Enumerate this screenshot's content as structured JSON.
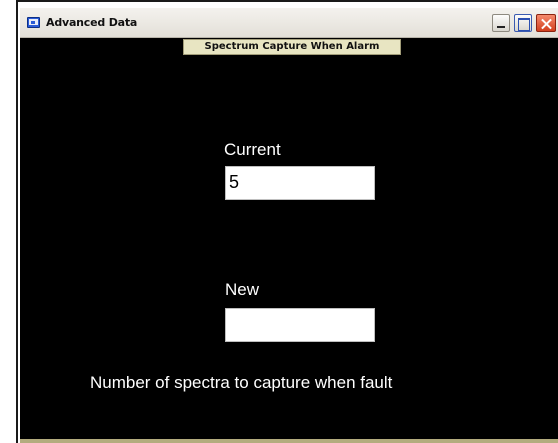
{
  "window": {
    "title": "Advanced Data"
  },
  "banner": {
    "text": "Spectrum Capture When Alarm"
  },
  "current": {
    "label": "Current",
    "value": "5"
  },
  "new": {
    "label": "New",
    "value": ""
  },
  "caption": "Number of spectra to capture when fault",
  "colors": {
    "background": "#000000",
    "text": "#ffffff",
    "banner": "#e8e5c2",
    "close": "#d2401f"
  },
  "icons": {
    "app": "app-window-icon",
    "minimize": "minimize-icon",
    "maximize": "maximize-icon",
    "close": "close-icon"
  }
}
